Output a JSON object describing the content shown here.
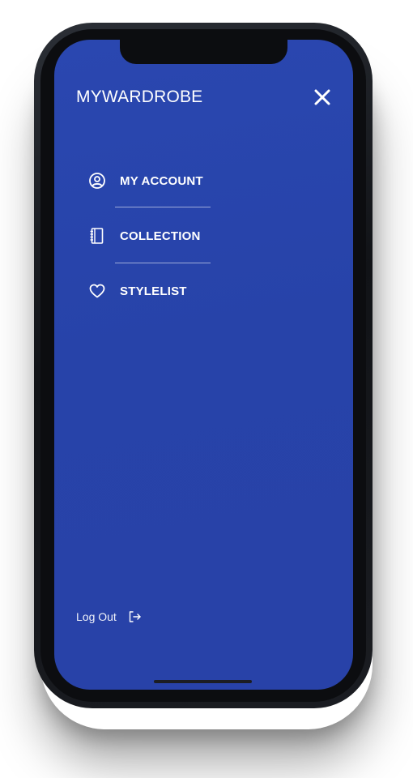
{
  "app": {
    "brand": "MYWARDROBE"
  },
  "menu": {
    "items": [
      {
        "label": "MY ACCOUNT",
        "icon": "user-circle-icon"
      },
      {
        "label": "COLLECTION",
        "icon": "notebook-icon"
      },
      {
        "label": "STYLELIST",
        "icon": "heart-icon"
      }
    ]
  },
  "footer": {
    "logout_label": "Log Out",
    "logout_icon": "logout-icon"
  },
  "colors": {
    "screen_background": "#2843A9",
    "text": "#FFFFFF",
    "device_frame": "#111317"
  }
}
